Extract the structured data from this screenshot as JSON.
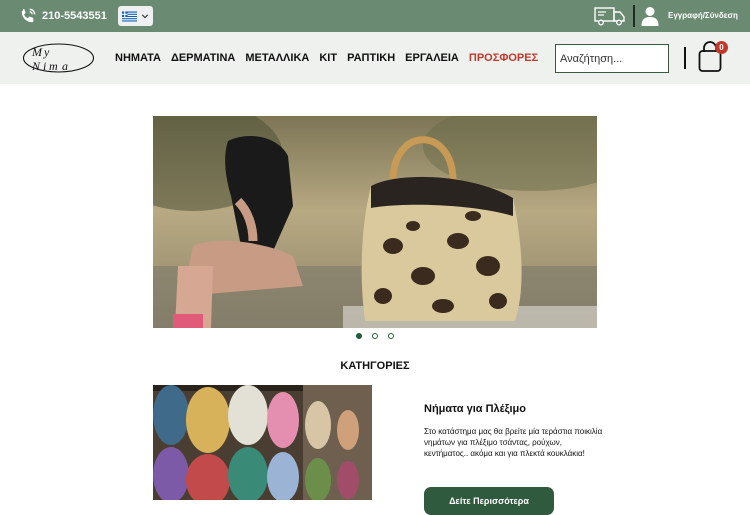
{
  "topbar": {
    "phone": "210-5543551",
    "login_label": "Εγγραφή/Σύνδεση"
  },
  "header": {
    "logo_text": "My Nima",
    "nav": [
      {
        "label": "ΝΗΜΑΤΑ"
      },
      {
        "label": "ΔΕΡΜΑΤΙΝΑ"
      },
      {
        "label": "ΜΕΤΑΛΛΙΚΑ"
      },
      {
        "label": "ΚΙΤ"
      },
      {
        "label": "ΡΑΠΤΙΚΗ"
      },
      {
        "label": "ΕΡΓΑΛΕΙΑ"
      },
      {
        "label": "ΠΡΟΣΦΟΡΕΣ"
      }
    ],
    "search_placeholder": "Αναζήτηση...",
    "cart_count": "0"
  },
  "carousel": {
    "slides": 3,
    "active": 1
  },
  "categories": {
    "title": "ΚΑΤΗΓΟΡΙΕΣ",
    "item": {
      "name": "Νήματα για Πλέξιμο",
      "description": "Στο κατάστημα μας θα βρείτε μία τεράστια ποικιλία νημάτων για πλέξιμο τσάντας, ρούχων, κεντήματος.. ακόμα και για πλεκτά κουκλάκια!",
      "button_label": "Δείτε Περισσότερα"
    }
  },
  "colors": {
    "topbar": "#6b8a72",
    "header": "#eef1ee",
    "accent": "#2f5a3d",
    "offers": "#c0392b"
  }
}
